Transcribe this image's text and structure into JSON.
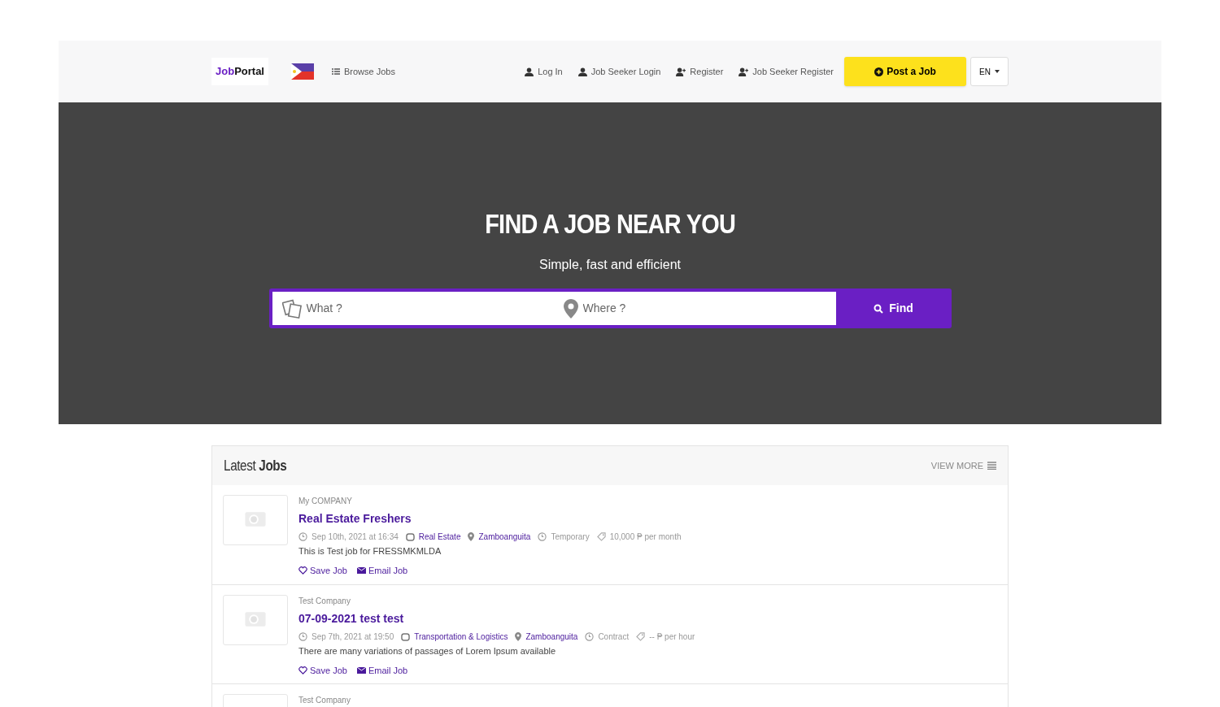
{
  "header": {
    "logo": {
      "first": "Job",
      "second": "Portal"
    },
    "browse": "Browse Jobs",
    "nav": [
      {
        "label": "Log In",
        "kind": "user"
      },
      {
        "label": "Job Seeker Login",
        "kind": "user"
      },
      {
        "label": "Register",
        "kind": "user-plus"
      },
      {
        "label": "Job Seeker Register",
        "kind": "user-plus"
      }
    ],
    "post_button": "Post a Job",
    "language": "EN"
  },
  "hero": {
    "title": "FIND A JOB NEAR YOU",
    "subtitle": "Simple, fast and efficient",
    "what": {
      "placeholder": "What ?"
    },
    "where": {
      "placeholder": "Where ?"
    },
    "find": "Find"
  },
  "latest": {
    "title": "Latest **Jobs**",
    "view_more": "VIEW MORE",
    "jobs": [
      {
        "company": "My COMPANY",
        "title": "Real Estate Freshers",
        "meta": [
          {
            "kind": "date",
            "text": "Sep 10th, 2021 at 16:34"
          },
          {
            "kind": "category",
            "text": "Real Estate"
          },
          {
            "kind": "location",
            "text": "Zamboanguita"
          },
          {
            "kind": "type",
            "text": "Temporary"
          },
          {
            "kind": "salary",
            "text": "10,000 ₱ per month"
          }
        ],
        "description": "This is Test job for FRESSMKMLDA",
        "save": "Save Job",
        "email": "Email Job"
      },
      {
        "company": "Test Company",
        "title": "07-09-2021 test test",
        "meta": [
          {
            "kind": "date",
            "text": "Sep 7th, 2021 at 19:50"
          },
          {
            "kind": "category",
            "text": "Transportation & Logistics"
          },
          {
            "kind": "location",
            "text": "Zamboanguita"
          },
          {
            "kind": "type",
            "text": "Contract"
          },
          {
            "kind": "salary",
            "text": "-- ₱ per hour"
          }
        ],
        "description": "There are many variations of passages of Lorem Ipsum available",
        "save": "Save Job",
        "email": "Email Job"
      },
      {
        "company": "Test Company"
      }
    ]
  }
}
